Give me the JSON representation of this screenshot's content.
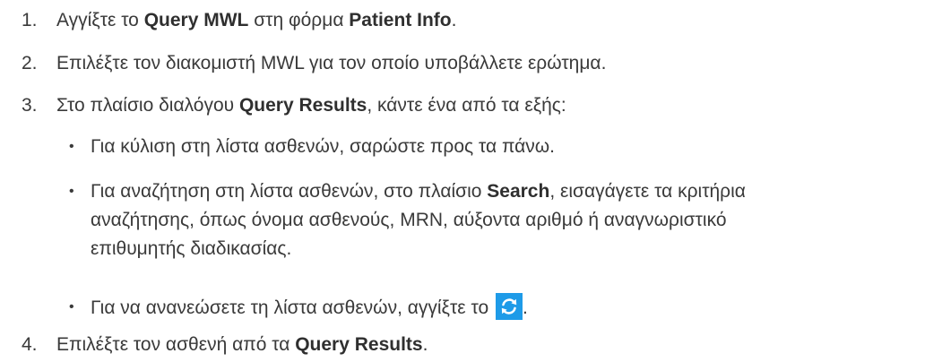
{
  "steps": [
    {
      "number": "1.",
      "text_before": "Αγγίξτε το ",
      "bold1": "Query MWL",
      "text_middle": " στη φόρμα ",
      "bold2": "Patient Info",
      "text_after": "."
    },
    {
      "number": "2.",
      "text": "Επιλέξτε τον διακομιστή MWL για τον οποίο υποβάλλετε ερώτημα."
    },
    {
      "number": "3.",
      "text_before": "Στο πλαίσιο διαλόγου ",
      "bold": "Query Results",
      "text_after": ", κάντε ένα από τα εξής:",
      "bullets": [
        {
          "text": "Για κύλιση στη λίστα ασθενών, σαρώστε προς τα πάνω."
        },
        {
          "text_before": "Για αναζήτηση στη λίστα ασθενών, στο πλαίσιο ",
          "bold": "Search",
          "text_after_line1": ", εισαγάγετε τα κριτήρια",
          "line2": "αναζήτησης, όπως όνομα ασθενούς, MRN, αύξοντα αριθμό ή αναγνωριστικό",
          "line3": "επιθυμητής διαδικασίας."
        },
        {
          "text_before": "Για να ανανεώσετε τη λίστα ασθενών, αγγίξτε το ",
          "icon": "refresh-icon",
          "text_after": "."
        }
      ]
    },
    {
      "number": "4.",
      "text_before": "Επιλέξτε τον ασθενή από τα ",
      "bold": "Query Results",
      "text_after": "."
    }
  ],
  "colors": {
    "text": "#3a3a3a",
    "icon": "#1e9be8"
  }
}
